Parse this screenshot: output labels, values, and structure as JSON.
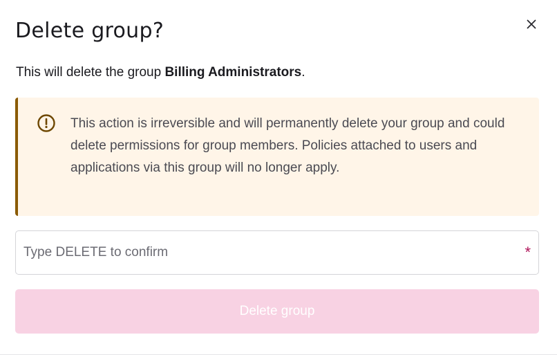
{
  "dialog": {
    "title": "Delete group?",
    "close_icon": "close-icon",
    "description_prefix": "This will delete the group ",
    "group_name": "Billing Administrators",
    "description_suffix": ".",
    "alert": {
      "icon": "alert-circle-icon",
      "text": "This action is irreversible and will permanently delete your group and could delete permissions for group members. Policies attached to users and applications via this group will no longer apply."
    },
    "confirm_input": {
      "placeholder": "Type DELETE to confirm",
      "value": "",
      "required_marker": "*"
    },
    "submit_label": "Delete group",
    "colors": {
      "warning_bg": "#fff5e8",
      "warning_accent": "#8a5a00",
      "required": "#b0155a",
      "button_disabled_bg": "#f8d2e3"
    }
  }
}
